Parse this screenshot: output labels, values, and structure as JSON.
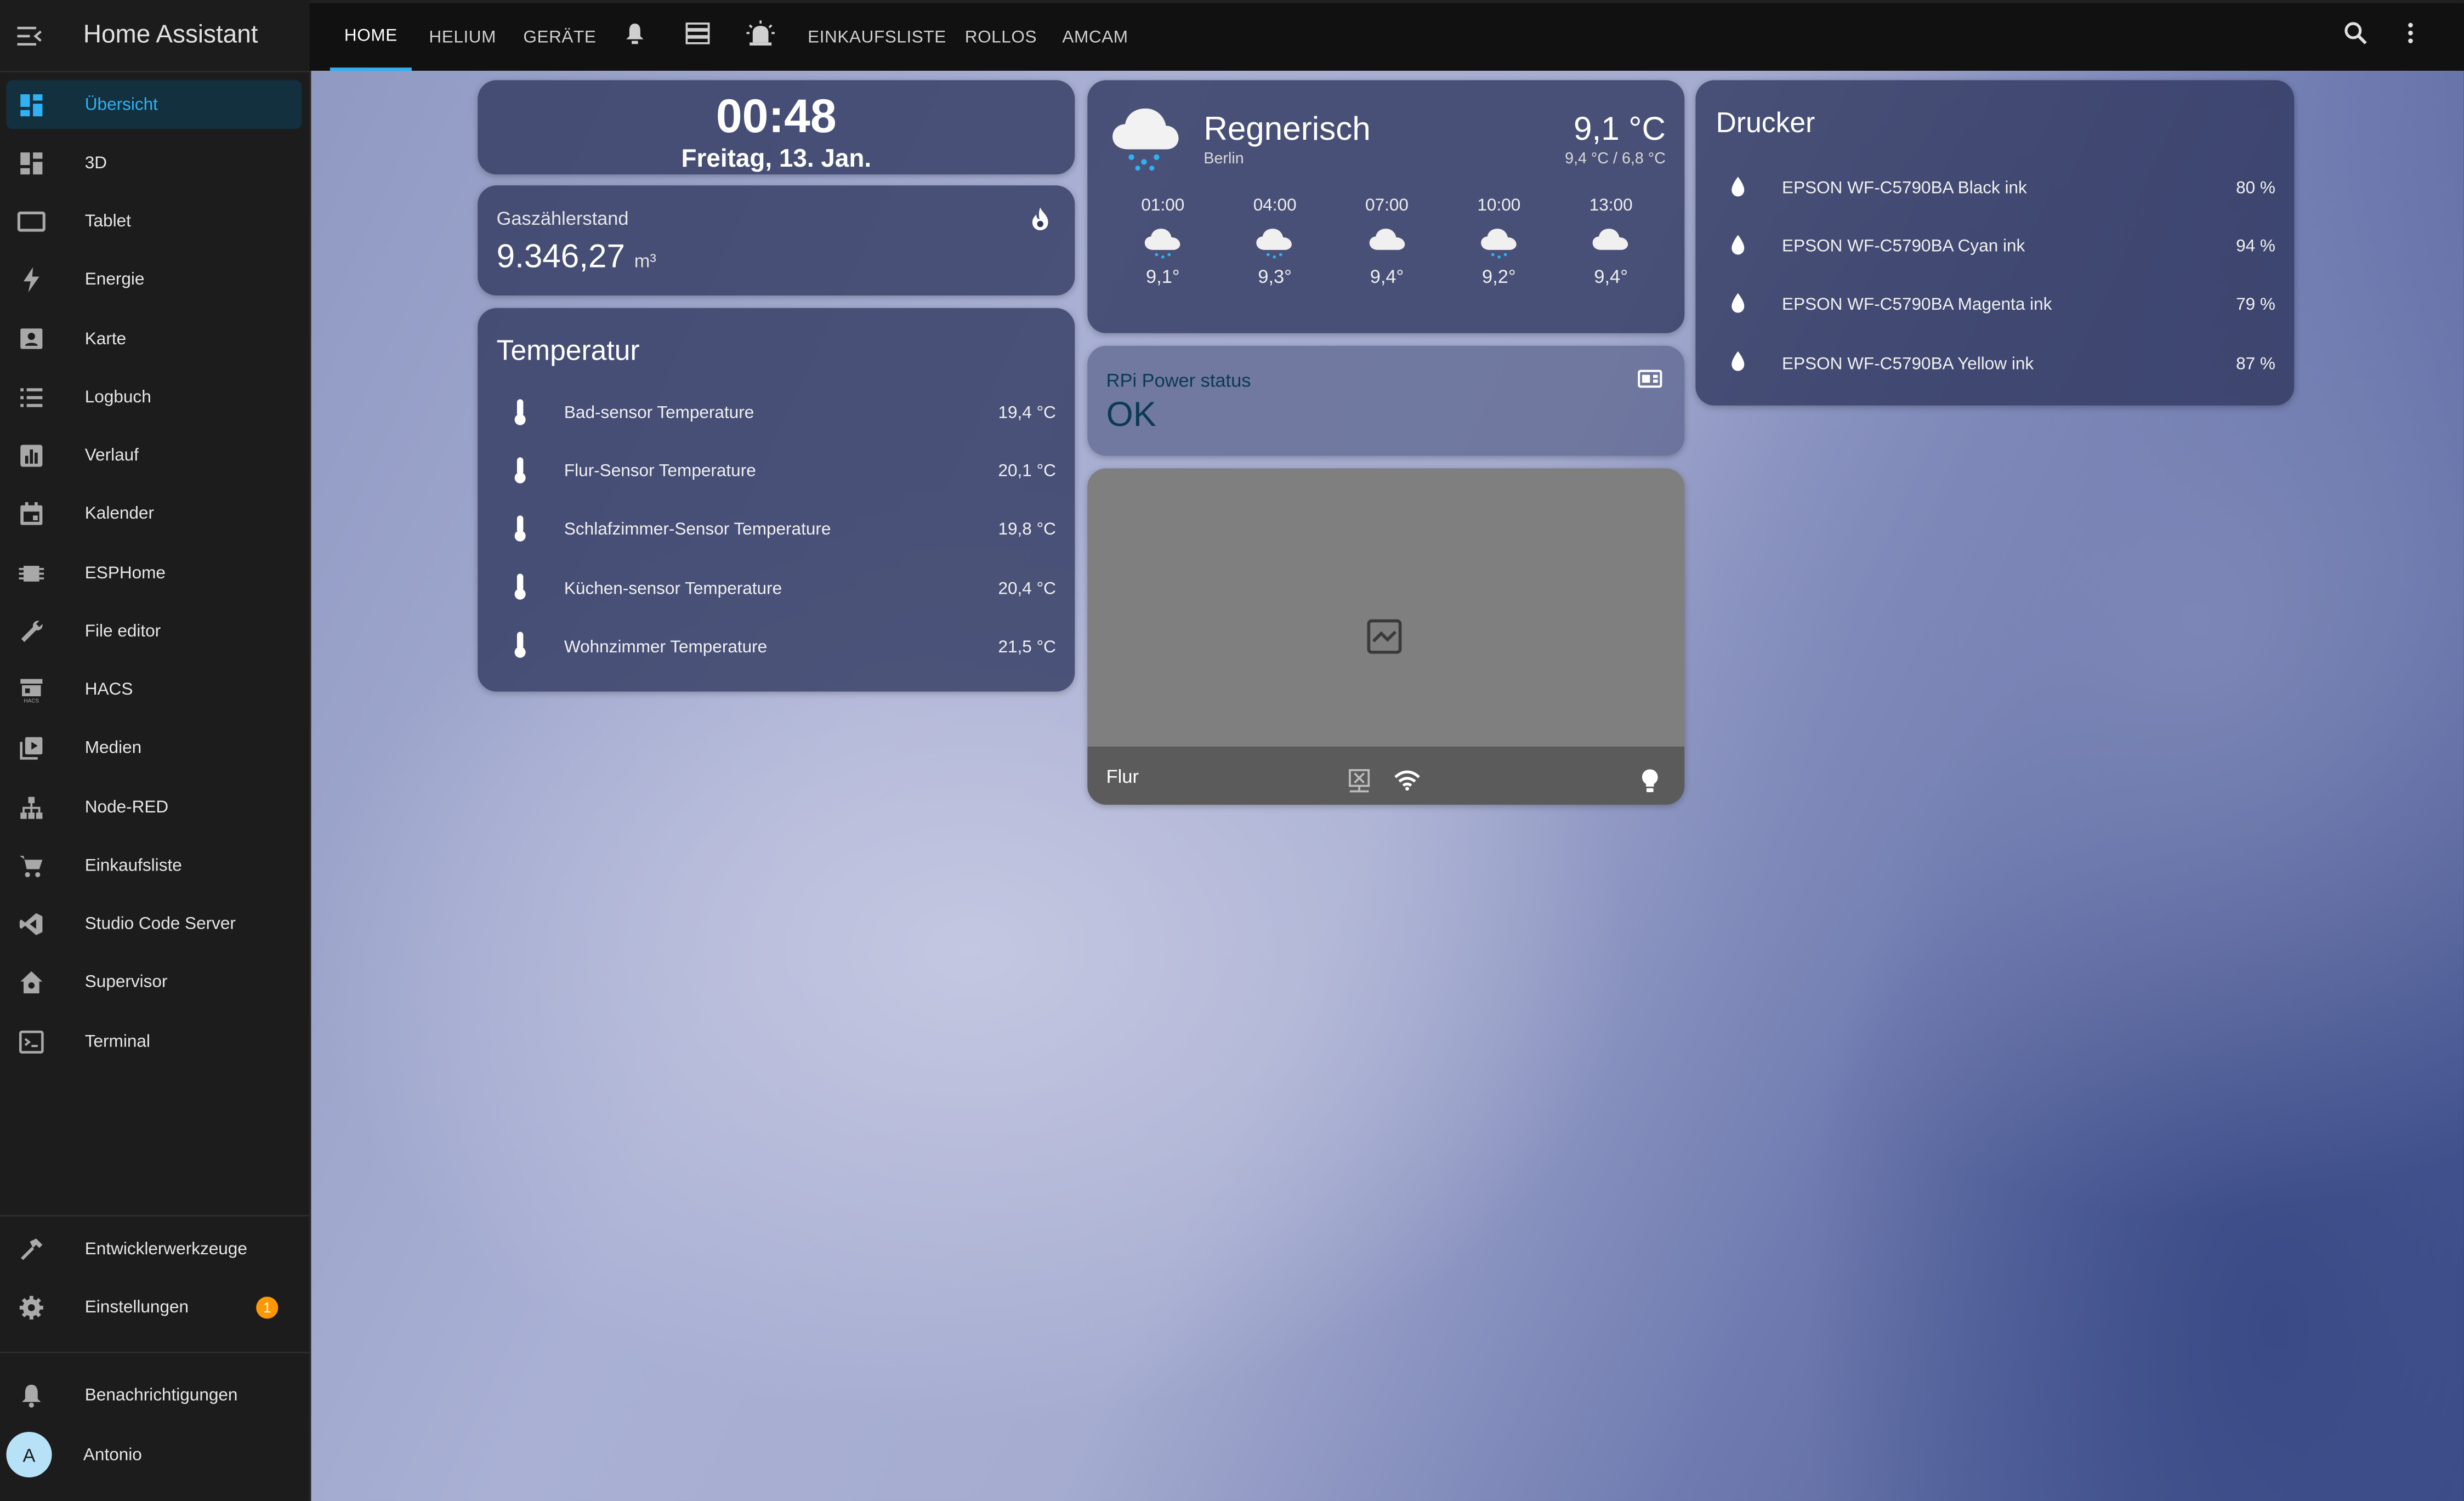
{
  "app": {
    "title": "Home Assistant"
  },
  "sidebar": {
    "items": [
      {
        "label": "Übersicht",
        "icon": "dashboard-icon"
      },
      {
        "label": "3D",
        "icon": "dashboard-icon"
      },
      {
        "label": "Tablet",
        "icon": "tablet-icon"
      },
      {
        "label": "Energie",
        "icon": "lightning-bolt-icon"
      },
      {
        "label": "Karte",
        "icon": "map-account-icon"
      },
      {
        "label": "Logbuch",
        "icon": "list-icon"
      },
      {
        "label": "Verlauf",
        "icon": "chart-box-icon"
      },
      {
        "label": "Kalender",
        "icon": "calendar-icon"
      },
      {
        "label": "ESPHome",
        "icon": "chip-icon"
      },
      {
        "label": "File editor",
        "icon": "wrench-icon"
      },
      {
        "label": "HACS",
        "icon": "hacs-store-icon"
      },
      {
        "label": "Medien",
        "icon": "play-box-icon"
      },
      {
        "label": "Node-RED",
        "icon": "sitemap-icon"
      },
      {
        "label": "Einkaufsliste",
        "icon": "cart-icon"
      },
      {
        "label": "Studio Code Server",
        "icon": "vscode-icon"
      },
      {
        "label": "Supervisor",
        "icon": "home-assistant-icon"
      },
      {
        "label": "Terminal",
        "icon": "console-icon"
      }
    ],
    "dev_tools": "Entwicklerwerkzeuge",
    "settings": "Einstellungen",
    "settings_badge": "1",
    "notifications": "Benachrichtigungen",
    "user_initial": "A",
    "user_name": "Antonio"
  },
  "tabs": [
    "HOME",
    "HELIUM",
    "GERÄTE",
    "EINKAUFSLISTE",
    "ROLLOS",
    "AMCAM"
  ],
  "clock": {
    "time": "00:48",
    "date": "Freitag, 13. Jan."
  },
  "gas": {
    "title": "Gaszählerstand",
    "value": "9.346,27",
    "unit": "m³"
  },
  "temperature": {
    "title": "Temperatur",
    "rows": [
      {
        "name": "Bad-sensor Temperature",
        "value": "19,4 °C"
      },
      {
        "name": "Flur-Sensor Temperature",
        "value": "20,1 °C"
      },
      {
        "name": "Schlafzimmer-Sensor Temperature",
        "value": "19,8 °C"
      },
      {
        "name": "Küchen-sensor Temperature",
        "value": "20,4 °C"
      },
      {
        "name": "Wohnzimmer Temperature",
        "value": "21,5 °C"
      }
    ]
  },
  "weather": {
    "condition": "Regnerisch",
    "location": "Berlin",
    "temp": "9,1 °C",
    "hilo": "9,4 °C / 6,8 °C",
    "forecast": [
      {
        "time": "01:00",
        "temp": "9,1°",
        "icon": "rainy-cloud-icon"
      },
      {
        "time": "04:00",
        "temp": "9,3°",
        "icon": "rainy-cloud-icon"
      },
      {
        "time": "07:00",
        "temp": "9,4°",
        "icon": "cloud-icon"
      },
      {
        "time": "10:00",
        "temp": "9,2°",
        "icon": "rainy-cloud-icon"
      },
      {
        "time": "13:00",
        "temp": "9,4°",
        "icon": "cloud-icon"
      }
    ]
  },
  "rpi": {
    "title": "RPi Power status",
    "value": "OK"
  },
  "camera": {
    "name": "Flur"
  },
  "printer": {
    "title": "Drucker",
    "rows": [
      {
        "name": "EPSON WF-C5790BA Black ink",
        "value": "80 %"
      },
      {
        "name": "EPSON WF-C5790BA Cyan ink",
        "value": "94 %"
      },
      {
        "name": "EPSON WF-C5790BA Magenta ink",
        "value": "79 %"
      },
      {
        "name": "EPSON WF-C5790BA Yellow ink",
        "value": "87 %"
      }
    ]
  },
  "colors": {
    "accent": "#2fb1f4",
    "badge": "#ff9800",
    "sidebar_bg": "#1c1c1c",
    "card_bg": "#2e365e"
  }
}
